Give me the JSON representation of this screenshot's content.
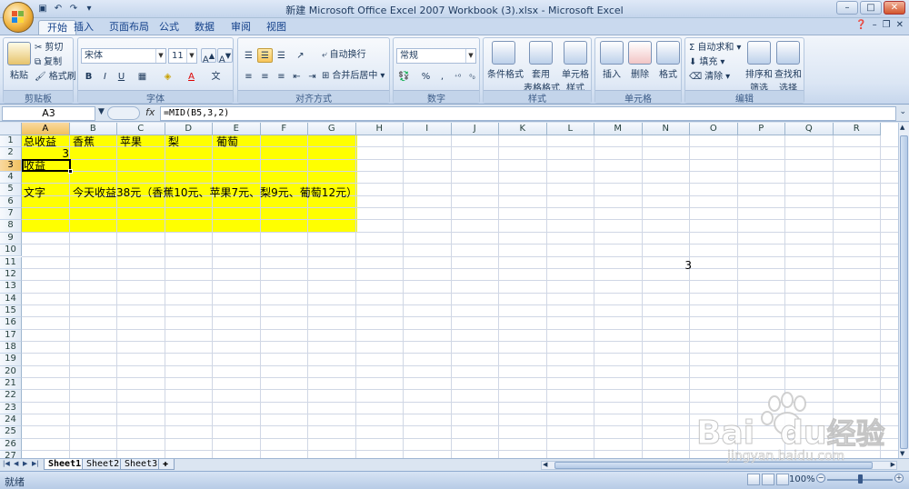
{
  "window": {
    "title": "新建 Microsoft Office Excel 2007 Workbook (3).xlsx - Microsoft Excel",
    "minimize": "–",
    "maximize": "□",
    "close": "✕"
  },
  "ribbon_tabs": [
    "开始",
    "插入",
    "页面布局",
    "公式",
    "数据",
    "审阅",
    "视图"
  ],
  "ribbon": {
    "clipboard": {
      "group": "剪贴板",
      "paste": "粘贴",
      "cut": "剪切",
      "copy": "复制",
      "painter": "格式刷"
    },
    "font": {
      "group": "字体",
      "name": "宋体",
      "size": "11",
      "bold": "B",
      "italic": "I",
      "underline": "U"
    },
    "alignment": {
      "group": "对齐方式",
      "wrap": "自动换行",
      "merge": "合并后居中"
    },
    "number": {
      "group": "数字",
      "format": "常规",
      "percent": "%",
      "comma": ","
    },
    "styles": {
      "group": "样式",
      "conditional": "条件格式",
      "table": "套用",
      "table2": "表格格式",
      "cell_styles": "单元格",
      "cell_styles2": "样式"
    },
    "cells": {
      "group": "单元格",
      "insert": "插入",
      "delete": "删除",
      "format": "格式"
    },
    "editing": {
      "group": "编辑",
      "autosum": "自动求和",
      "fill": "填充",
      "clear": "清除",
      "sort": "排序和",
      "sort2": "筛选",
      "find": "查找和",
      "find2": "选择"
    }
  },
  "formula_bar": {
    "name_box": "A3",
    "fx": "fx",
    "formula": "=MID(B5,3,2)"
  },
  "columns": [
    "A",
    "B",
    "C",
    "D",
    "E",
    "F",
    "G",
    "H",
    "I",
    "J",
    "K",
    "L",
    "M",
    "N",
    "O",
    "P",
    "Q",
    "R"
  ],
  "rows": [
    "1",
    "2",
    "3",
    "4",
    "5",
    "6",
    "7",
    "8",
    "9",
    "10",
    "11",
    "12",
    "13",
    "14",
    "15",
    "16",
    "17",
    "18",
    "19",
    "20",
    "21",
    "22",
    "23",
    "24",
    "25",
    "26",
    "27"
  ],
  "cells": {
    "A1": "总收益",
    "B1": "香蕉",
    "C1": "苹果",
    "D1": "梨",
    "E1": "葡萄",
    "A2": "3",
    "A3": "收益",
    "A5": "文字",
    "B5": "今天收益38元（香蕉10元、苹果7元、梨9元、葡萄12元）",
    "N11": "3"
  },
  "fill_color": "#ffff00",
  "sheets": [
    "Sheet1",
    "Sheet2",
    "Sheet3"
  ],
  "active_sheet": "Sheet1",
  "status": {
    "mode": "就绪",
    "zoom": "100%"
  },
  "watermark": {
    "brand": "Bai",
    "brand2": "du",
    "brand_cn": "经验",
    "url": "jingyan.baidu.com"
  }
}
